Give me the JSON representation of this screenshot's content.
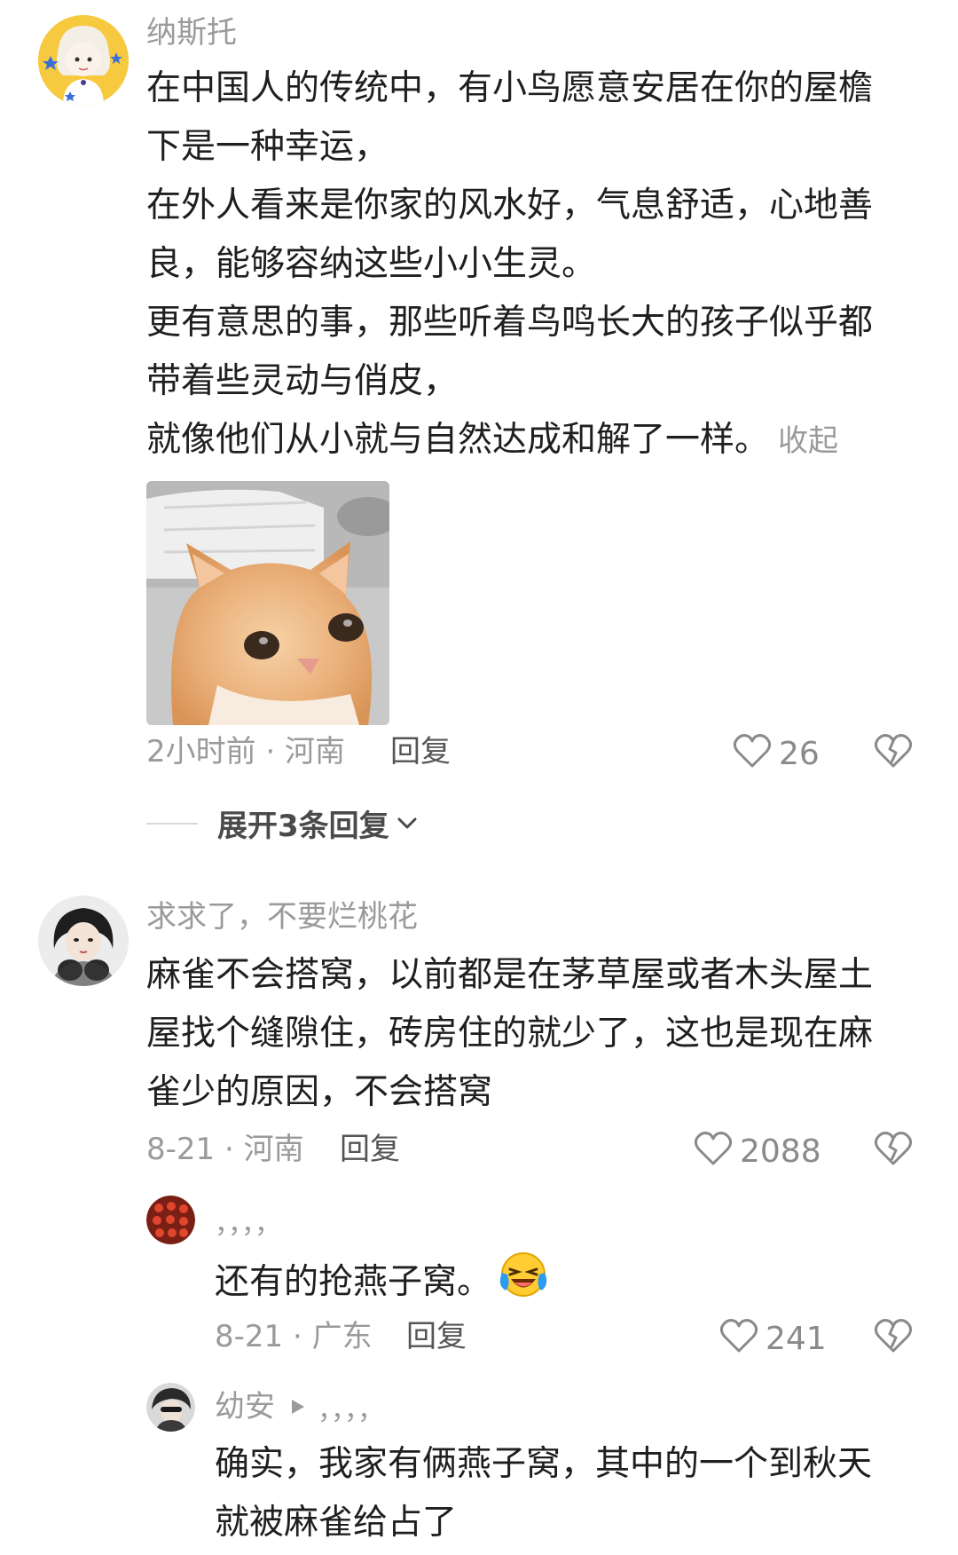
{
  "comments": [
    {
      "username": "纳斯托",
      "lines": [
        "在中国人的传统中，有小鸟愿意安居在你的屋檐",
        "下是一种幸运，",
        "在外人看来是你家的风水好，气息舒适，心地善",
        "良，能够容纳这些小小生灵。",
        "更有意思的事，那些听着鸟鸣长大的孩子似乎都",
        "带着些灵动与俏皮，",
        "就像他们从小就与自然达成和解了一样。"
      ],
      "collapse_label": "收起",
      "meta": "2小时前 · 河南",
      "reply_label": "回复",
      "likes": "26",
      "expand_label": "展开3条回复"
    },
    {
      "username": "求求了，不要烂桃花",
      "lines": [
        "麻雀不会搭窝，以前都是在茅草屋或者木头屋土",
        "屋找个缝隙住，砖房住的就少了，这也是现在麻",
        "雀少的原因，不会搭窝"
      ],
      "meta": "8-21 · 河南",
      "reply_label": "回复",
      "likes": "2088"
    }
  ],
  "replies": [
    {
      "username": "，，，，",
      "text": "还有的抢燕子窝。",
      "meta": "8-21 · 广东",
      "reply_label": "回复",
      "likes": "241"
    },
    {
      "username": "幼安",
      "reply_to": "，，，，",
      "lines": [
        "确实，我家有俩燕子窝，其中的一个到秋天",
        "就被麻雀给占了"
      ]
    }
  ],
  "icons": {
    "like": "heart-outline-icon",
    "dislike": "broken-heart-icon",
    "expand": "chevron-down-icon",
    "reply_arrow": "play-triangle-icon",
    "emoji": "laughing-crying-emoji"
  },
  "colors": {
    "text": "#1f1f1f",
    "muted": "#9a9a9a",
    "background": "#ffffff"
  }
}
